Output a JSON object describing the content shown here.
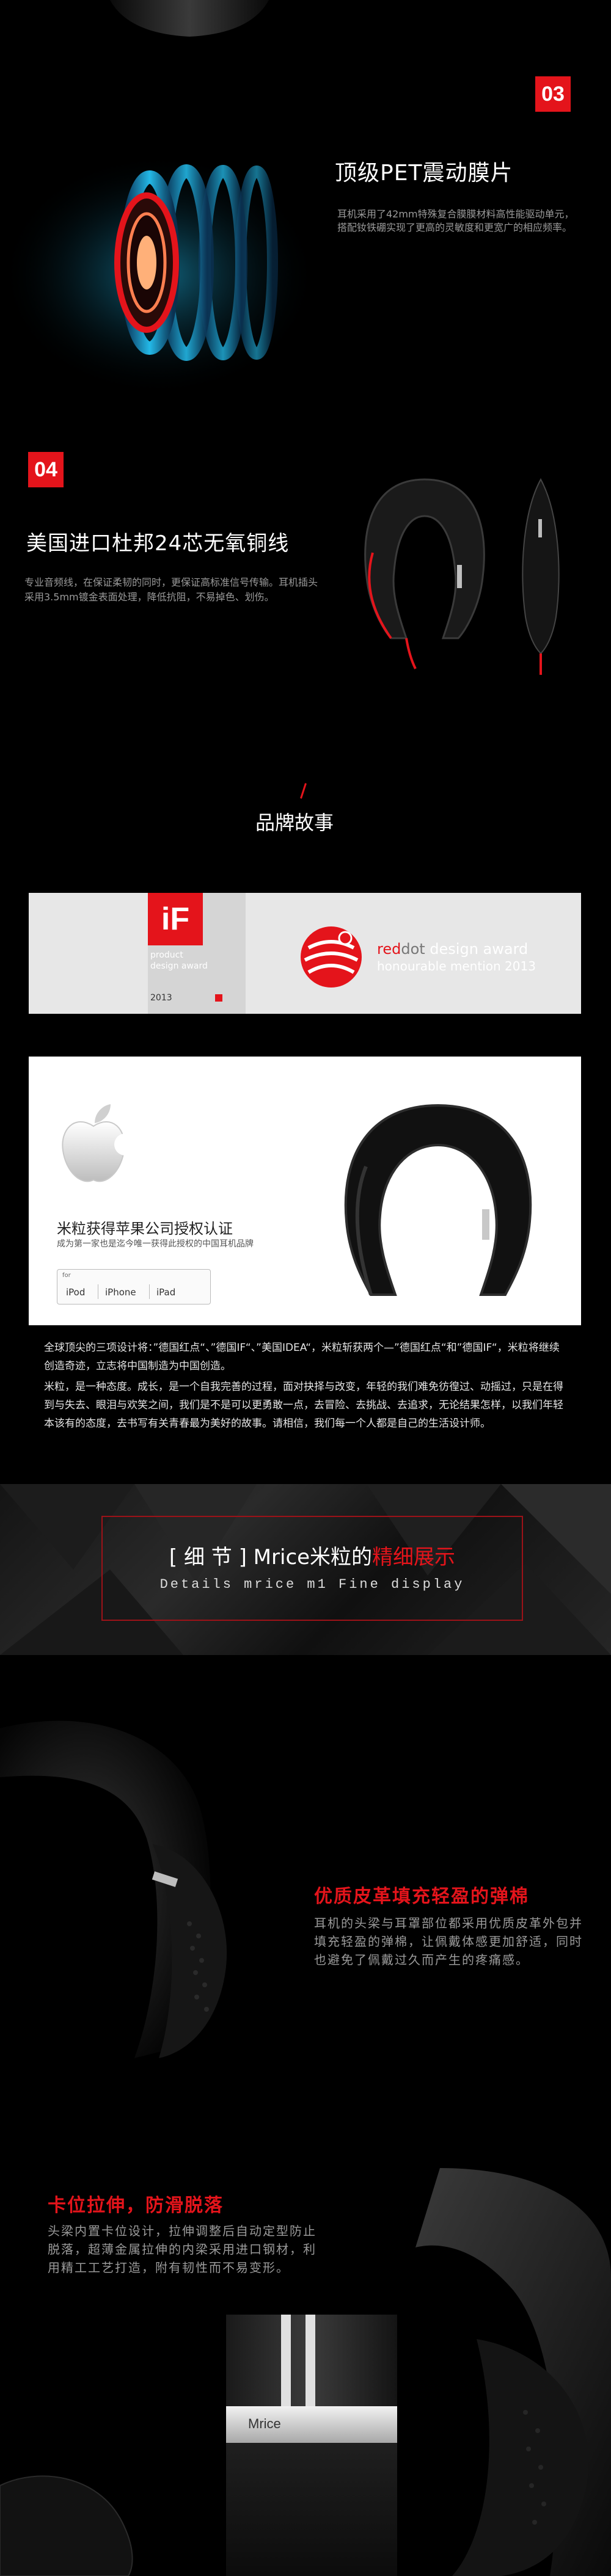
{
  "sec03": {
    "number": "03",
    "title": "顶级PET震动膜片",
    "desc": "耳机采用了42mm特殊复合膜膜材料高性能驱动单元，搭配钕铁硼实现了更高的灵敏度和更宽广的相应频率。"
  },
  "sec04": {
    "number": "04",
    "title": "美国进口杜邦24芯无氧铜线",
    "desc": "专业音频线，在保证柔韧的同时，更保证高标准信号传输。耳机插头采用3.5mm镀金表面处理，降低抗阻，不易掉色、划伤。"
  },
  "brand": {
    "title": "品牌故事",
    "if_award": {
      "logo": "iF",
      "line1": "product",
      "line2": "design award",
      "year": "2013"
    },
    "reddot": {
      "brand_red": "red",
      "brand_dot": "dot",
      "rest": " design award",
      "sub": "honourable mention 2013"
    },
    "apple": {
      "title": "米粒获得苹果公司授权认证",
      "subtitle": "成为第一家也是迄今唯一获得此授权的中国耳机品牌",
      "for_label": "for",
      "devices": [
        "iPod",
        "iPhone",
        "iPad"
      ]
    },
    "para1": "全球顶尖的三项设计将：”德国红点“、”德国IF“、”美国IDEA“，米粒斩获两个—”德国红点“和”德国IF“，米粒将继续创造奇迹，立志将中国制造为中国创造。",
    "para2": "米粒，是一种态度。成长，是一个自我完善的过程，面对抉择与改变，年轻的我们难免彷徨过、动摇过，只是在得到与失去、眼泪与欢笑之间，我们是不是可以更勇敢一点，去冒险、去挑战、去追求，无论结果怎样，以我们年轻本该有的态度，去书写有关青春最为美好的故事。请相信，我们每一个人都是自己的生活设计师。"
  },
  "details": {
    "title_bracket": "[ 细 节 ]",
    "title_mid": " Mrice米粒的",
    "title_red": "精细展示",
    "subtitle": "Details mrice m1 Fine display"
  },
  "feature1": {
    "title": "优质皮革填充轻盈的弹棉",
    "desc": "耳机的头梁与耳罩部位都采用优质皮革外包并填充轻盈的弹棉，让佩戴体感更加舒适，同时也避免了佩戴过久而产生的疼痛感。"
  },
  "feature2": {
    "title": "卡位拉伸，防滑脱落",
    "desc": "头梁内置卡位设计，拉伸调整后自动定型防止脱落，超薄金属拉伸的内梁采用进口钢材，利用精工工艺打造，附有韧性而不易变形。",
    "brand_mark": "Mrice"
  },
  "colors": {
    "accent": "#e4141b",
    "glow": "#1fb5e6"
  }
}
